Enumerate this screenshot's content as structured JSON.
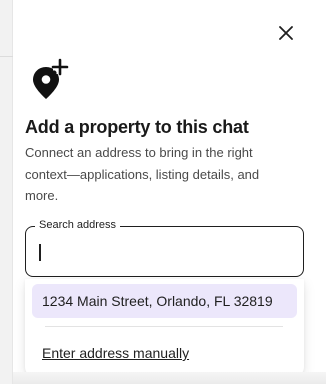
{
  "dialog": {
    "close_icon": "close-icon",
    "header_icon": "add-location-pin-icon",
    "title": "Add a property to this chat",
    "description": "Connect an address to bring in the right context—applications, listing details, and more."
  },
  "search": {
    "label": "Search address",
    "value": "",
    "placeholder": ""
  },
  "dropdown": {
    "suggestions": [
      {
        "label": "1234 Main Street, Orlando, FL 32819"
      }
    ],
    "manual_link": "Enter address manually"
  },
  "colors": {
    "suggestion_highlight": "#ece7fb",
    "text": "#1f1f1f",
    "muted_text": "#4a4a4a"
  }
}
